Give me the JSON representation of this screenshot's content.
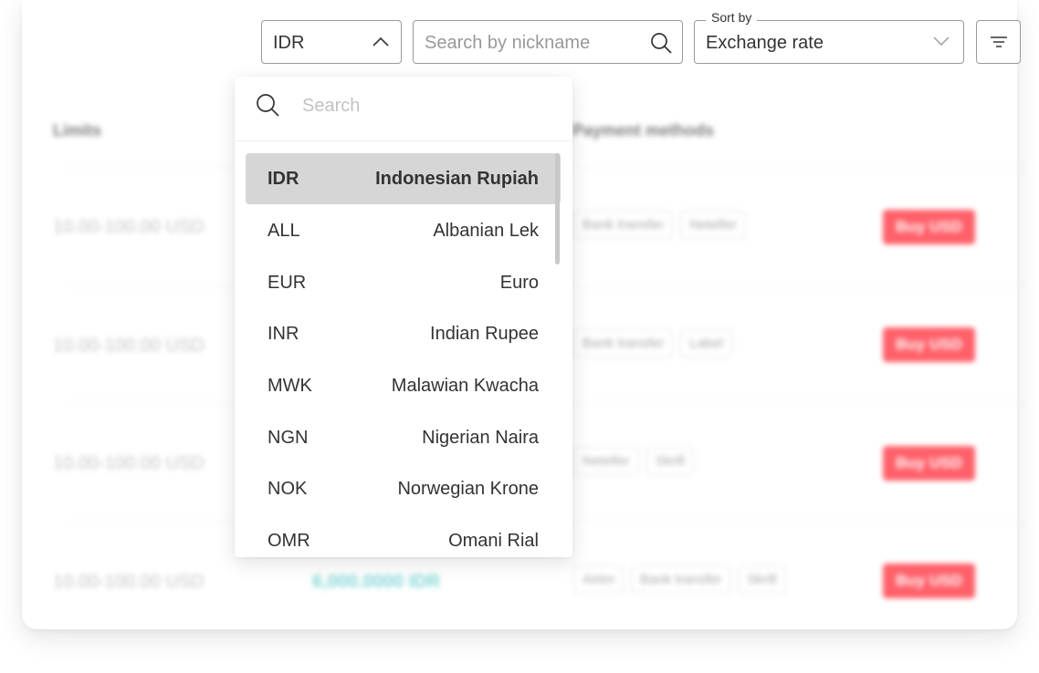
{
  "toolbar": {
    "currency_value": "IDR",
    "search_placeholder": "Search by nickname",
    "sort_label": "Sort by",
    "sort_value": "Exchange rate"
  },
  "dropdown": {
    "search_placeholder": "Search",
    "options": [
      {
        "code": "IDR",
        "name": "Indonesian Rupiah",
        "selected": true
      },
      {
        "code": "ALL",
        "name": "Albanian Lek"
      },
      {
        "code": "EUR",
        "name": "Euro"
      },
      {
        "code": "INR",
        "name": "Indian Rupee"
      },
      {
        "code": "MWK",
        "name": "Malawian Kwacha"
      },
      {
        "code": "NGN",
        "name": "Nigerian Naira"
      },
      {
        "code": "NOK",
        "name": "Norwegian Krone"
      },
      {
        "code": "OMR",
        "name": "Omani Rial"
      }
    ]
  },
  "table": {
    "headers": {
      "limits": "Limits",
      "payment_methods": "Payment methods"
    },
    "rows": [
      {
        "limits": "10.00-100.00 USD",
        "methods": [
          "Bank transfer",
          "Neteller"
        ],
        "action": "Buy USD"
      },
      {
        "limits": "10.00-100.00 USD",
        "methods": [
          "Bank transfer",
          "Label"
        ],
        "action": "Buy USD"
      },
      {
        "limits": "10.00-100.00 USD",
        "methods": [
          "Neteller",
          "Skrill"
        ],
        "action": "Buy USD"
      },
      {
        "limits": "10.00-100.00 USD",
        "price": "6,000.0000 IDR",
        "methods": [
          "Airtm",
          "Bank transfer",
          "Skrill"
        ],
        "action": "Buy USD"
      }
    ]
  },
  "colors": {
    "accent": "#ff444f",
    "price": "#6ecfcf",
    "selected_bg": "#d6d6d6"
  },
  "icons": [
    "chevron-up-icon",
    "search-icon",
    "chevron-down-icon",
    "filter-icon"
  ]
}
